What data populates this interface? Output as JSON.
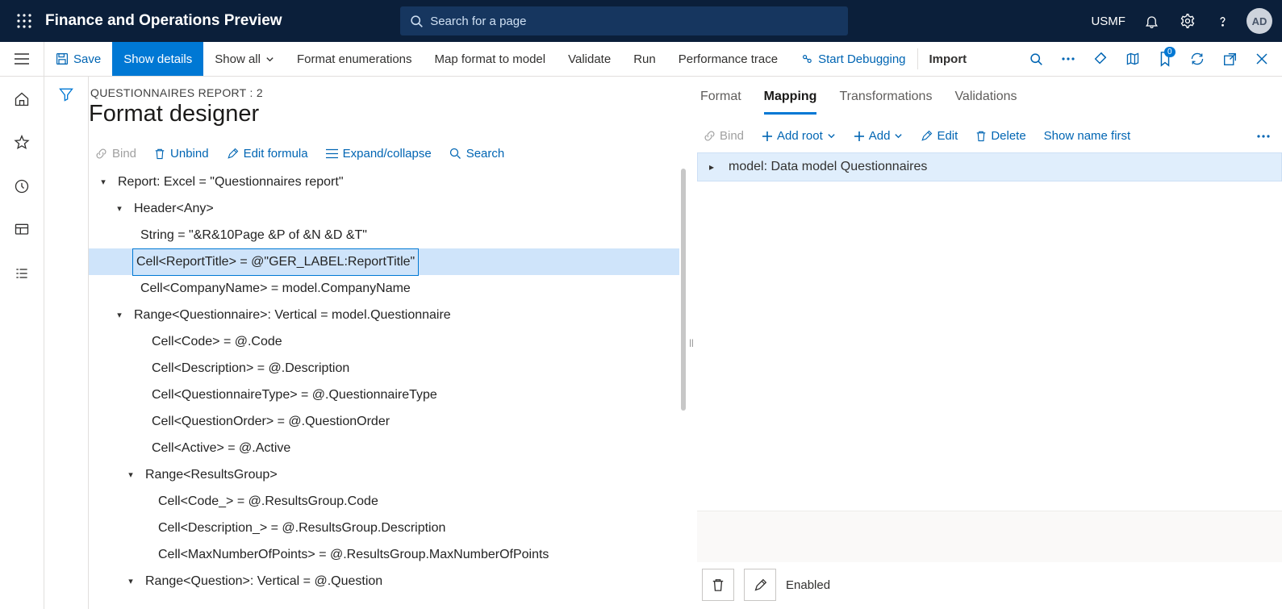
{
  "topbar": {
    "app_title": "Finance and Operations Preview",
    "search_placeholder": "Search for a page",
    "company": "USMF",
    "avatar": "AD"
  },
  "cmdbar": {
    "save": "Save",
    "show_details": "Show details",
    "show_all": "Show all",
    "format_enum": "Format enumerations",
    "map_format": "Map format to model",
    "validate": "Validate",
    "run": "Run",
    "perf_trace": "Performance trace",
    "start_debug": "Start Debugging",
    "import": "Import",
    "badge": "0"
  },
  "page": {
    "breadcrumb": "QUESTIONNAIRES REPORT : 2",
    "title": "Format designer"
  },
  "tree_toolbar": {
    "bind": "Bind",
    "unbind": "Unbind",
    "edit_formula": "Edit formula",
    "expand_collapse": "Expand/collapse",
    "search": "Search"
  },
  "tree": {
    "n0": "Report: Excel = \"Questionnaires report\"",
    "n1": "Header<Any>",
    "n2": "String = \"&R&10Page &P of &N &D &T\"",
    "n3": "Cell<ReportTitle> = @\"GER_LABEL:ReportTitle\"",
    "n4": "Cell<CompanyName> = model.CompanyName",
    "n5": "Range<Questionnaire>: Vertical = model.Questionnaire",
    "n6": "Cell<Code> = @.Code",
    "n7": "Cell<Description> = @.Description",
    "n8": "Cell<QuestionnaireType> = @.QuestionnaireType",
    "n9": "Cell<QuestionOrder> = @.QuestionOrder",
    "n10": "Cell<Active> = @.Active",
    "n11": "Range<ResultsGroup>",
    "n12": "Cell<Code_> = @.ResultsGroup.Code",
    "n13": "Cell<Description_> = @.ResultsGroup.Description",
    "n14": "Cell<MaxNumberOfPoints> = @.ResultsGroup.MaxNumberOfPoints",
    "n15": "Range<Question>: Vertical = @.Question"
  },
  "right": {
    "tabs": {
      "format": "Format",
      "mapping": "Mapping",
      "transformations": "Transformations",
      "validations": "Validations"
    },
    "toolbar": {
      "bind": "Bind",
      "add_root": "Add root",
      "add": "Add",
      "edit": "Edit",
      "delete": "Delete",
      "show_name": "Show name first"
    },
    "model_row": "model: Data model Questionnaires",
    "enabled_label": "Enabled"
  }
}
